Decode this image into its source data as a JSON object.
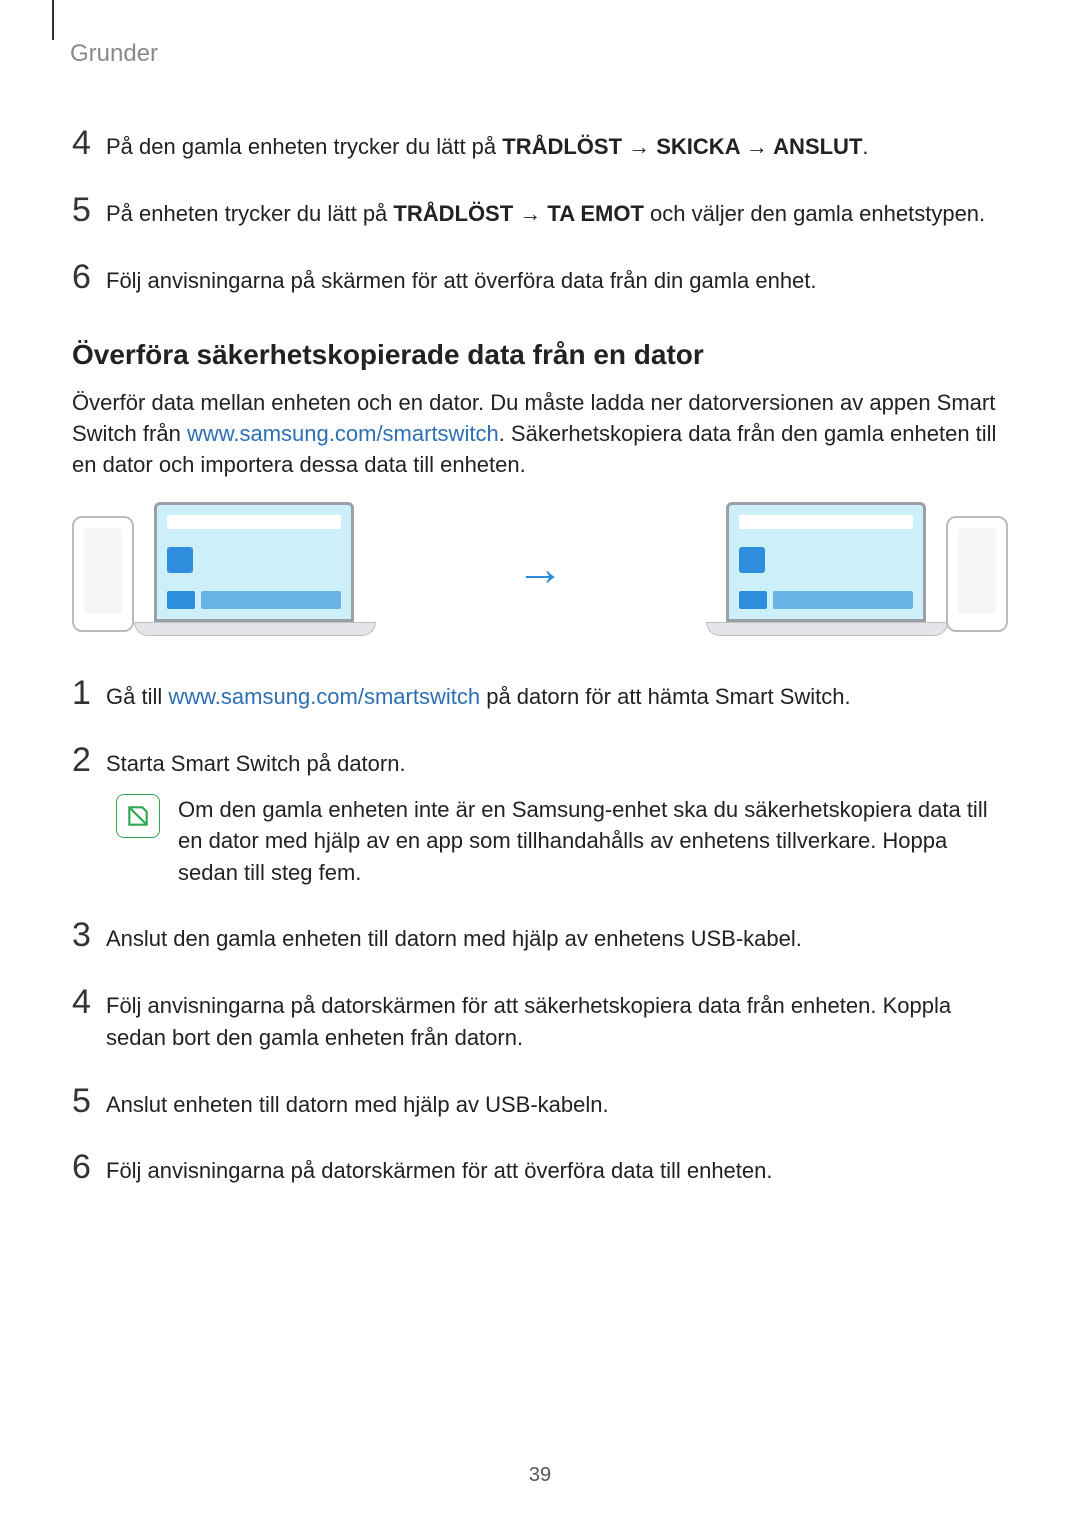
{
  "header": "Grunder",
  "stepsA": [
    {
      "n": "4",
      "pre": "På den gamla enheten trycker du lätt på ",
      "bold": "TRÅDLÖST → SKICKA → ANSLUT",
      "post": "."
    },
    {
      "n": "5",
      "pre": "På enheten trycker du lätt på ",
      "bold": "TRÅDLÖST → TA EMOT",
      "post": " och väljer den gamla enhetstypen."
    },
    {
      "n": "6",
      "pre": "Följ anvisningarna på skärmen för att överföra data från din gamla enhet.",
      "bold": "",
      "post": ""
    }
  ],
  "sectionTitle": "Överföra säkerhetskopierade data från en dator",
  "introPre": "Överför data mellan enheten och en dator. Du måste ladda ner datorversionen av appen Smart Switch från ",
  "introLink": "www.samsung.com/smartswitch",
  "introPost": ". Säkerhetskopiera data från den gamla enheten till en dator och importera dessa data till enheten.",
  "stepsB": [
    {
      "n": "1",
      "pre": "Gå till ",
      "link": "www.samsung.com/smartswitch",
      "post": " på datorn för att hämta Smart Switch."
    },
    {
      "n": "2",
      "pre": "Starta Smart Switch på datorn.",
      "link": "",
      "post": ""
    }
  ],
  "noteText": "Om den gamla enheten inte är en Samsung-enhet ska du säkerhetskopiera data till en dator med hjälp av en app som tillhandahålls av enhetens tillverkare. Hoppa sedan till steg fem.",
  "stepsC": [
    {
      "n": "3",
      "text": "Anslut den gamla enheten till datorn med hjälp av enhetens USB-kabel."
    },
    {
      "n": "4",
      "text": "Följ anvisningarna på datorskärmen för att säkerhetskopiera data från enheten. Koppla sedan bort den gamla enheten från datorn."
    },
    {
      "n": "5",
      "text": "Anslut enheten till datorn med hjälp av USB-kabeln."
    },
    {
      "n": "6",
      "text": "Följ anvisningarna på datorskärmen för att överföra data till enheten."
    }
  ],
  "pageNumber": "39"
}
